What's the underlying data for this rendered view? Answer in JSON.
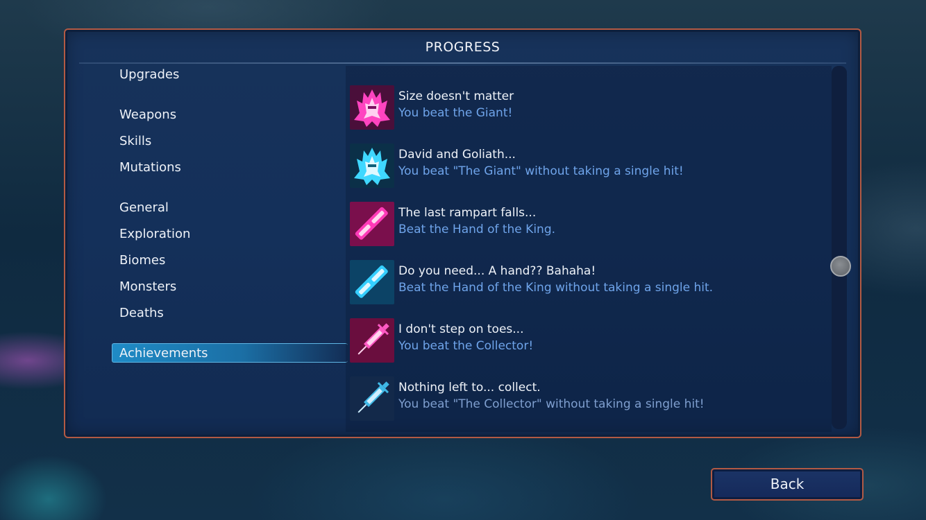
{
  "panel": {
    "title": "PROGRESS"
  },
  "nav": {
    "items": [
      {
        "label": "Upgrades"
      },
      {
        "label": "Weapons"
      },
      {
        "label": "Skills"
      },
      {
        "label": "Mutations"
      },
      {
        "label": "General"
      },
      {
        "label": "Exploration"
      },
      {
        "label": "Biomes"
      },
      {
        "label": "Monsters"
      },
      {
        "label": "Deaths"
      },
      {
        "label": "Achievements"
      }
    ],
    "active": "Achievements"
  },
  "achievements": [
    {
      "title": "Size doesn't matter",
      "desc": "You beat the Giant!",
      "icon": "giant-pink-icon"
    },
    {
      "title": "David and Goliath...",
      "desc": "You beat \"The Giant\" without taking a single hit!",
      "icon": "giant-cyan-icon"
    },
    {
      "title": "The last rampart falls...",
      "desc": "Beat the Hand of the King.",
      "icon": "hand-pink-icon"
    },
    {
      "title": "Do you need... A hand?? Bahaha!",
      "desc": "Beat the Hand of the King without taking a single hit.",
      "icon": "hand-cyan-icon"
    },
    {
      "title": "I don't step on toes...",
      "desc": "You beat the Collector!",
      "icon": "syringe-pink-icon"
    },
    {
      "title": "Nothing left to... collect.",
      "desc": "You beat \"The Collector\" without taking a single hit!",
      "icon": "syringe-cyan-icon"
    }
  ],
  "footer": {
    "back_label": "Back"
  },
  "colors": {
    "panel_border": "#b35a44",
    "active_tab": "#1f8bc6",
    "desc_text": "#6fa4ea",
    "pink_icon": "#ff2fb0",
    "cyan_icon": "#3fd8ff"
  }
}
